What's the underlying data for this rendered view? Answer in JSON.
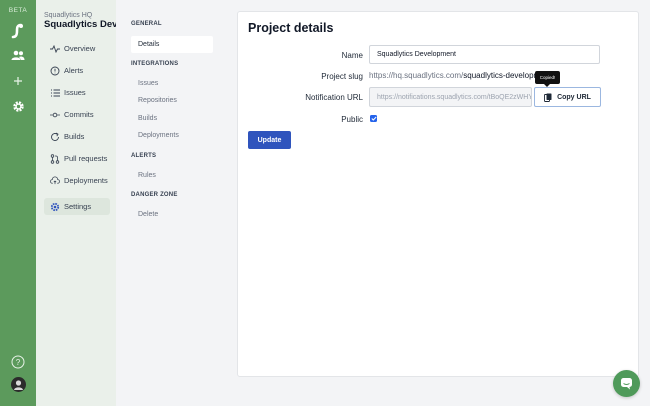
{
  "colors": {
    "rail": "#5c9a5c",
    "accent_blue": "#2f54bd",
    "checkbox": "#2563eb",
    "chat": "#4f9a5a"
  },
  "rail": {
    "badge": "BETA",
    "icons": [
      "logo-icon",
      "users-icon",
      "plus-icon",
      "gear-icon",
      "help-icon",
      "avatar"
    ]
  },
  "project": {
    "org": "Squadlytics HQ",
    "name": "Squadlytics Devel…",
    "nav": [
      {
        "label": "Overview",
        "icon": "pulse-icon"
      },
      {
        "label": "Alerts",
        "icon": "alert-circle-icon"
      },
      {
        "label": "Issues",
        "icon": "list-icon"
      },
      {
        "label": "Commits",
        "icon": "commit-icon"
      },
      {
        "label": "Builds",
        "icon": "refresh-icon"
      },
      {
        "label": "Pull requests",
        "icon": "pull-request-icon"
      },
      {
        "label": "Deployments",
        "icon": "cloud-upload-icon"
      },
      {
        "label": "Settings",
        "icon": "gear-icon"
      }
    ],
    "active": "Settings"
  },
  "settings_nav": {
    "general_heading": "GENERAL",
    "details": "Details",
    "integrations_heading": "INTEGRATIONS",
    "issues": "Issues",
    "repositories": "Repositories",
    "builds": "Builds",
    "deployments": "Deployments",
    "alerts_heading": "ALERTS",
    "rules": "Rules",
    "danger_heading": "DANGER ZONE",
    "delete": "Delete"
  },
  "form": {
    "title": "Project details",
    "name_label": "Name",
    "name_value": "Squadlytics Development",
    "slug_label": "Project slug",
    "slug_prefix": "https://hq.squadlytics.com/",
    "slug_value": "squadlytics-development",
    "url_label": "Notification URL",
    "url_value": "https://notifications.squadlytics.com/tBoQE2zWHYk",
    "copy_button": "Copy URL",
    "tooltip": "Copied!",
    "public_label": "Public",
    "public_checked": true,
    "update_button": "Update"
  }
}
